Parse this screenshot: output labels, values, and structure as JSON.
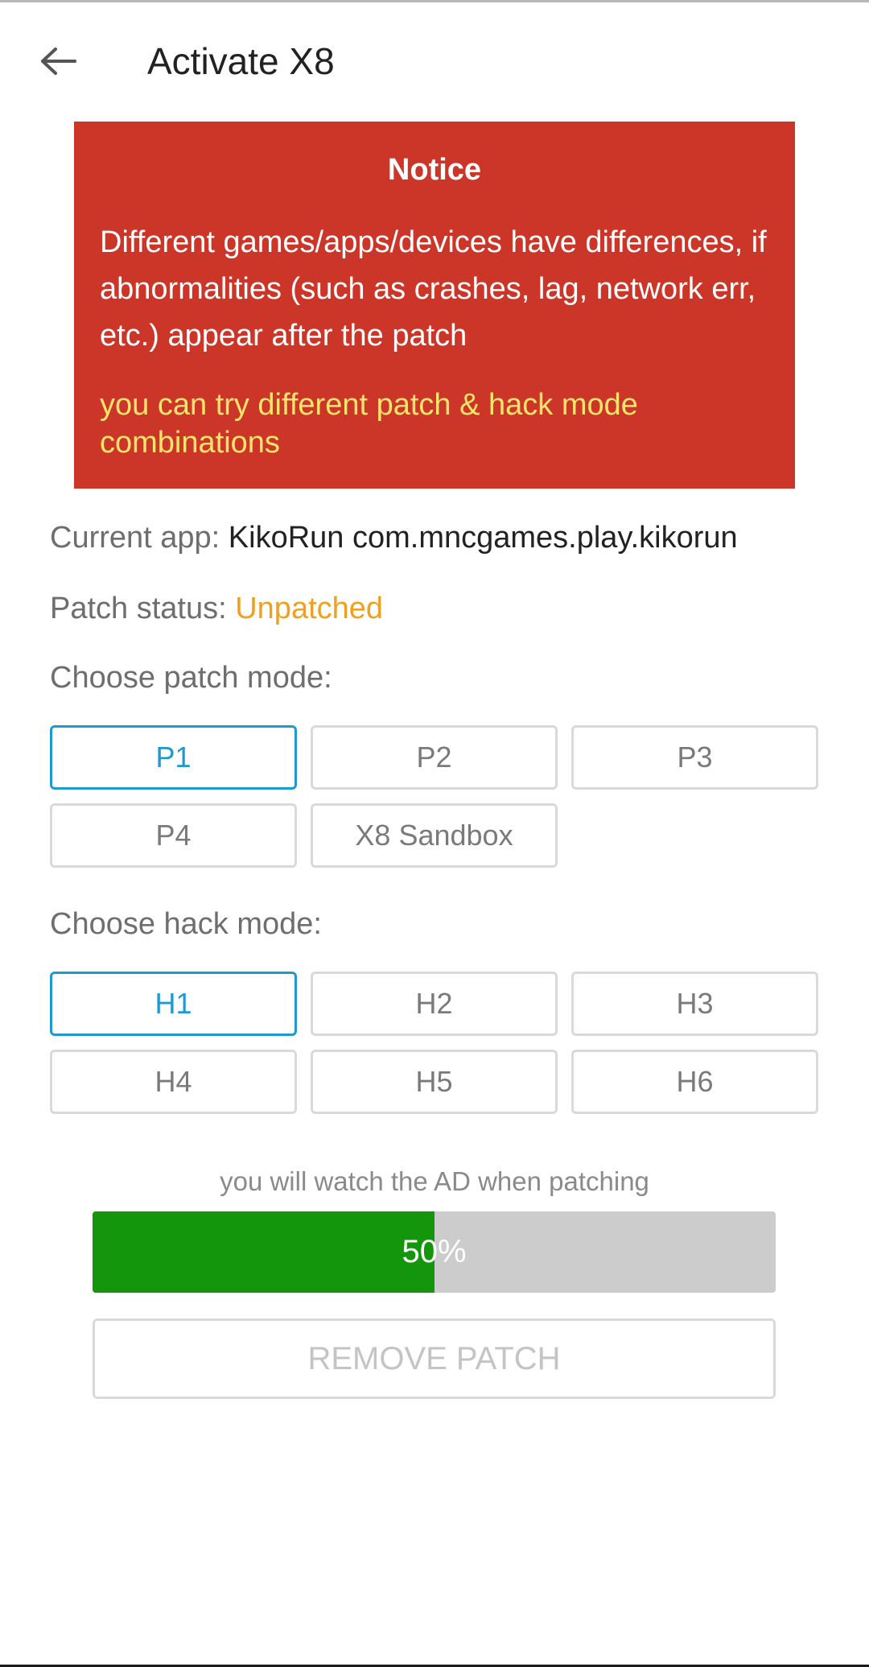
{
  "header": {
    "title": "Activate X8",
    "back_icon": "arrow-left-icon"
  },
  "notice": {
    "title": "Notice",
    "body": "Different games/apps/devices have differences, if abnormalities (such as crashes, lag, network err, etc.) appear after the patch",
    "hint": "you can try different patch & hack mode combinations",
    "background_color": "#cc3628",
    "hint_color": "#f7e46c"
  },
  "info": {
    "current_app_label": "Current app:",
    "current_app_value": "KikoRun com.mncgames.play.kikorun",
    "patch_status_label": "Patch status:",
    "patch_status_value": "Unpatched",
    "status_color": "#f0a020"
  },
  "patch_mode": {
    "label": "Choose patch mode:",
    "options": [
      "P1",
      "P2",
      "P3",
      "P4",
      "X8 Sandbox"
    ],
    "selected": "P1"
  },
  "hack_mode": {
    "label": "Choose hack mode:",
    "options": [
      "H1",
      "H2",
      "H3",
      "H4",
      "H5",
      "H6"
    ],
    "selected": "H1"
  },
  "ad_note": "you will watch the AD when patching",
  "progress": {
    "label": "50%",
    "value": 0.5,
    "fill_color": "#14960c"
  },
  "remove_button": {
    "label": "REMOVE PATCH"
  },
  "accent_color": "#1e9ad0"
}
